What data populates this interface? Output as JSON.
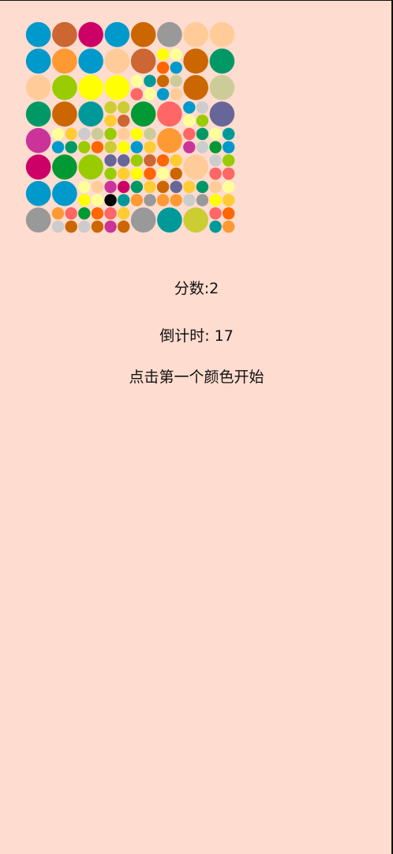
{
  "game": {
    "score_text": "分数:2",
    "timer_text": "倒计时: 17",
    "hint_text": "点击第一个颜色开始"
  },
  "palette": {
    "bg": "#FEDCCF",
    "colors": {
      "b": "#0099CC",
      "o": "#CC6633",
      "m": "#CC0066",
      "ob": "#CC6600",
      "g": "#999999",
      "p": "#FFCC99",
      "t": "#009966",
      "or": "#FF9933",
      "y": "#FFFF00",
      "l": "#99CC00",
      "gr": "#009933",
      "c": "#FF6666",
      "v": "#666699",
      "k": "#000000",
      "pu": "#CC3399",
      "tl": "#009999",
      "lg": "#CCCCCC",
      "ol": "#CCCC33",
      "lo": "#CCCC99",
      "ly": "#FFFF99",
      "og": "#FF6600",
      "ye": "#FFCC33"
    }
  },
  "board": {
    "cells": [
      {
        "col": 0,
        "row": 0,
        "span": 2,
        "color": "b"
      },
      {
        "col": 2,
        "row": 0,
        "span": 2,
        "color": "o"
      },
      {
        "col": 4,
        "row": 0,
        "span": 2,
        "color": "m"
      },
      {
        "col": 6,
        "row": 0,
        "span": 2,
        "color": "b"
      },
      {
        "col": 8,
        "row": 0,
        "span": 2,
        "color": "ob"
      },
      {
        "col": 10,
        "row": 0,
        "span": 2,
        "color": "g"
      },
      {
        "col": 12,
        "row": 0,
        "span": 2,
        "color": "p"
      },
      {
        "col": 14,
        "row": 0,
        "span": 2,
        "color": "p"
      },
      {
        "col": 0,
        "row": 2,
        "span": 2,
        "color": "b"
      },
      {
        "col": 2,
        "row": 2,
        "span": 2,
        "color": "or"
      },
      {
        "col": 4,
        "row": 2,
        "span": 2,
        "color": "b"
      },
      {
        "col": 6,
        "row": 2,
        "span": 2,
        "color": "p"
      },
      {
        "col": 8,
        "row": 2,
        "span": 2,
        "color": "o"
      },
      {
        "col": 10,
        "row": 2,
        "span": 1,
        "color": "y"
      },
      {
        "col": 11,
        "row": 2,
        "span": 1,
        "color": "ly"
      },
      {
        "col": 10,
        "row": 3,
        "span": 1,
        "color": "og"
      },
      {
        "col": 11,
        "row": 3,
        "span": 1,
        "color": "b"
      },
      {
        "col": 12,
        "row": 2,
        "span": 2,
        "color": "ob"
      },
      {
        "col": 14,
        "row": 2,
        "span": 2,
        "color": "t"
      },
      {
        "col": 0,
        "row": 4,
        "span": 2,
        "color": "p"
      },
      {
        "col": 2,
        "row": 4,
        "span": 2,
        "color": "l"
      },
      {
        "col": 4,
        "row": 4,
        "span": 2,
        "color": "y"
      },
      {
        "col": 6,
        "row": 4,
        "span": 2,
        "color": "y"
      },
      {
        "col": 8,
        "row": 4,
        "span": 1,
        "color": "ly"
      },
      {
        "col": 9,
        "row": 4,
        "span": 1,
        "color": "tl"
      },
      {
        "col": 8,
        "row": 5,
        "span": 1,
        "color": "c"
      },
      {
        "col": 9,
        "row": 5,
        "span": 1,
        "color": "ly"
      },
      {
        "col": 10,
        "row": 4,
        "span": 1,
        "color": "ob"
      },
      {
        "col": 11,
        "row": 4,
        "span": 1,
        "color": "lo"
      },
      {
        "col": 10,
        "row": 5,
        "span": 1,
        "color": "b"
      },
      {
        "col": 11,
        "row": 5,
        "span": 1,
        "color": "p"
      },
      {
        "col": 12,
        "row": 4,
        "span": 2,
        "color": "ob"
      },
      {
        "col": 14,
        "row": 4,
        "span": 2,
        "color": "lo"
      },
      {
        "col": 0,
        "row": 6,
        "span": 2,
        "color": "t"
      },
      {
        "col": 2,
        "row": 6,
        "span": 2,
        "color": "ob"
      },
      {
        "col": 4,
        "row": 6,
        "span": 2,
        "color": "tl"
      },
      {
        "col": 6,
        "row": 6,
        "span": 1,
        "color": "ol"
      },
      {
        "col": 7,
        "row": 6,
        "span": 1,
        "color": "ol"
      },
      {
        "col": 6,
        "row": 7,
        "span": 1,
        "color": "ye"
      },
      {
        "col": 7,
        "row": 7,
        "span": 1,
        "color": "o"
      },
      {
        "col": 8,
        "row": 6,
        "span": 2,
        "color": "gr"
      },
      {
        "col": 10,
        "row": 6,
        "span": 2,
        "color": "c"
      },
      {
        "col": 12,
        "row": 6,
        "span": 1,
        "color": "b"
      },
      {
        "col": 13,
        "row": 6,
        "span": 1,
        "color": "lg"
      },
      {
        "col": 12,
        "row": 7,
        "span": 1,
        "color": "ly"
      },
      {
        "col": 13,
        "row": 7,
        "span": 1,
        "color": "l"
      },
      {
        "col": 14,
        "row": 6,
        "span": 2,
        "color": "v"
      },
      {
        "col": 0,
        "row": 8,
        "span": 2,
        "color": "pu"
      },
      {
        "col": 2,
        "row": 8,
        "span": 1,
        "color": "ly"
      },
      {
        "col": 3,
        "row": 8,
        "span": 1,
        "color": "ye"
      },
      {
        "col": 2,
        "row": 9,
        "span": 1,
        "color": "b"
      },
      {
        "col": 3,
        "row": 9,
        "span": 1,
        "color": "t"
      },
      {
        "col": 4,
        "row": 8,
        "span": 1,
        "color": "lg"
      },
      {
        "col": 5,
        "row": 8,
        "span": 1,
        "color": "lo"
      },
      {
        "col": 4,
        "row": 9,
        "span": 1,
        "color": "l"
      },
      {
        "col": 5,
        "row": 9,
        "span": 1,
        "color": "og"
      },
      {
        "col": 6,
        "row": 8,
        "span": 1,
        "color": "l"
      },
      {
        "col": 7,
        "row": 8,
        "span": 1,
        "color": "p"
      },
      {
        "col": 6,
        "row": 9,
        "span": 1,
        "color": "ol"
      },
      {
        "col": 7,
        "row": 9,
        "span": 1,
        "color": "y"
      },
      {
        "col": 8,
        "row": 8,
        "span": 1,
        "color": "y"
      },
      {
        "col": 9,
        "row": 8,
        "span": 1,
        "color": "lo"
      },
      {
        "col": 8,
        "row": 9,
        "span": 1,
        "color": "b"
      },
      {
        "col": 9,
        "row": 9,
        "span": 1,
        "color": "ye"
      },
      {
        "col": 10,
        "row": 8,
        "span": 2,
        "color": "or"
      },
      {
        "col": 12,
        "row": 8,
        "span": 1,
        "color": "c"
      },
      {
        "col": 13,
        "row": 8,
        "span": 1,
        "color": "t"
      },
      {
        "col": 12,
        "row": 9,
        "span": 1,
        "color": "pu"
      },
      {
        "col": 13,
        "row": 9,
        "span": 1,
        "color": "lg"
      },
      {
        "col": 14,
        "row": 8,
        "span": 1,
        "color": "ly"
      },
      {
        "col": 15,
        "row": 8,
        "span": 1,
        "color": "tl"
      },
      {
        "col": 14,
        "row": 9,
        "span": 1,
        "color": "gr"
      },
      {
        "col": 15,
        "row": 9,
        "span": 1,
        "color": "b"
      },
      {
        "col": 0,
        "row": 10,
        "span": 2,
        "color": "m"
      },
      {
        "col": 2,
        "row": 10,
        "span": 2,
        "color": "gr"
      },
      {
        "col": 4,
        "row": 10,
        "span": 2,
        "color": "l"
      },
      {
        "col": 6,
        "row": 10,
        "span": 1,
        "color": "v"
      },
      {
        "col": 7,
        "row": 10,
        "span": 1,
        "color": "v"
      },
      {
        "col": 6,
        "row": 11,
        "span": 1,
        "color": "l"
      },
      {
        "col": 7,
        "row": 11,
        "span": 1,
        "color": "ye"
      },
      {
        "col": 8,
        "row": 10,
        "span": 1,
        "color": "l"
      },
      {
        "col": 9,
        "row": 10,
        "span": 1,
        "color": "o"
      },
      {
        "col": 8,
        "row": 11,
        "span": 1,
        "color": "y"
      },
      {
        "col": 9,
        "row": 11,
        "span": 1,
        "color": "og"
      },
      {
        "col": 10,
        "row": 10,
        "span": 1,
        "color": "og"
      },
      {
        "col": 11,
        "row": 10,
        "span": 1,
        "color": "ye"
      },
      {
        "col": 10,
        "row": 11,
        "span": 1,
        "color": "ly"
      },
      {
        "col": 11,
        "row": 11,
        "span": 1,
        "color": "ob"
      },
      {
        "col": 12,
        "row": 10,
        "span": 2,
        "color": "p"
      },
      {
        "col": 14,
        "row": 10,
        "span": 1,
        "color": "lg"
      },
      {
        "col": 15,
        "row": 10,
        "span": 1,
        "color": "l"
      },
      {
        "col": 14,
        "row": 11,
        "span": 1,
        "color": "c"
      },
      {
        "col": 15,
        "row": 11,
        "span": 1,
        "color": "c"
      },
      {
        "col": 0,
        "row": 12,
        "span": 2,
        "color": "b"
      },
      {
        "col": 2,
        "row": 12,
        "span": 2,
        "color": "b"
      },
      {
        "col": 4,
        "row": 12,
        "span": 1,
        "color": "ly"
      },
      {
        "col": 5,
        "row": 12,
        "span": 1,
        "color": "p"
      },
      {
        "col": 4,
        "row": 13,
        "span": 1,
        "color": "y"
      },
      {
        "col": 5,
        "row": 13,
        "span": 1,
        "color": "ly"
      },
      {
        "col": 6,
        "row": 12,
        "span": 1,
        "color": "pu"
      },
      {
        "col": 7,
        "row": 12,
        "span": 1,
        "color": "m"
      },
      {
        "col": 6,
        "row": 13,
        "span": 1,
        "color": "k"
      },
      {
        "col": 7,
        "row": 13,
        "span": 1,
        "color": "tl"
      },
      {
        "col": 8,
        "row": 12,
        "span": 1,
        "color": "t"
      },
      {
        "col": 9,
        "row": 12,
        "span": 1,
        "color": "ye"
      },
      {
        "col": 8,
        "row": 13,
        "span": 1,
        "color": "or"
      },
      {
        "col": 9,
        "row": 13,
        "span": 1,
        "color": "g"
      },
      {
        "col": 10,
        "row": 12,
        "span": 1,
        "color": "ob"
      },
      {
        "col": 11,
        "row": 12,
        "span": 1,
        "color": "v"
      },
      {
        "col": 10,
        "row": 13,
        "span": 1,
        "color": "or"
      },
      {
        "col": 11,
        "row": 13,
        "span": 1,
        "color": "or"
      },
      {
        "col": 12,
        "row": 12,
        "span": 1,
        "color": "ye"
      },
      {
        "col": 13,
        "row": 12,
        "span": 1,
        "color": "t"
      },
      {
        "col": 12,
        "row": 13,
        "span": 1,
        "color": "lg"
      },
      {
        "col": 13,
        "row": 13,
        "span": 1,
        "color": "g"
      },
      {
        "col": 14,
        "row": 12,
        "span": 1,
        "color": "p"
      },
      {
        "col": 15,
        "row": 12,
        "span": 1,
        "color": "ly"
      },
      {
        "col": 14,
        "row": 13,
        "span": 1,
        "color": "y"
      },
      {
        "col": 15,
        "row": 13,
        "span": 1,
        "color": "ye"
      },
      {
        "col": 0,
        "row": 14,
        "span": 2,
        "color": "g"
      },
      {
        "col": 2,
        "row": 14,
        "span": 1,
        "color": "or"
      },
      {
        "col": 3,
        "row": 14,
        "span": 1,
        "color": "c"
      },
      {
        "col": 2,
        "row": 15,
        "span": 1,
        "color": "lg"
      },
      {
        "col": 3,
        "row": 15,
        "span": 1,
        "color": "ob"
      },
      {
        "col": 4,
        "row": 14,
        "span": 1,
        "color": "gr"
      },
      {
        "col": 5,
        "row": 14,
        "span": 1,
        "color": "og"
      },
      {
        "col": 4,
        "row": 15,
        "span": 1,
        "color": "lg"
      },
      {
        "col": 5,
        "row": 15,
        "span": 1,
        "color": "ob"
      },
      {
        "col": 6,
        "row": 14,
        "span": 1,
        "color": "c"
      },
      {
        "col": 7,
        "row": 14,
        "span": 1,
        "color": "ye"
      },
      {
        "col": 6,
        "row": 15,
        "span": 1,
        "color": "pu"
      },
      {
        "col": 7,
        "row": 15,
        "span": 1,
        "color": "ob"
      },
      {
        "col": 8,
        "row": 14,
        "span": 2,
        "color": "g"
      },
      {
        "col": 10,
        "row": 14,
        "span": 2,
        "color": "tl"
      },
      {
        "col": 12,
        "row": 14,
        "span": 2,
        "color": "ol"
      },
      {
        "col": 14,
        "row": 14,
        "span": 1,
        "color": "c"
      },
      {
        "col": 15,
        "row": 14,
        "span": 1,
        "color": "og"
      },
      {
        "col": 14,
        "row": 15,
        "span": 1,
        "color": "tl"
      },
      {
        "col": 15,
        "row": 15,
        "span": 1,
        "color": "or"
      }
    ]
  }
}
